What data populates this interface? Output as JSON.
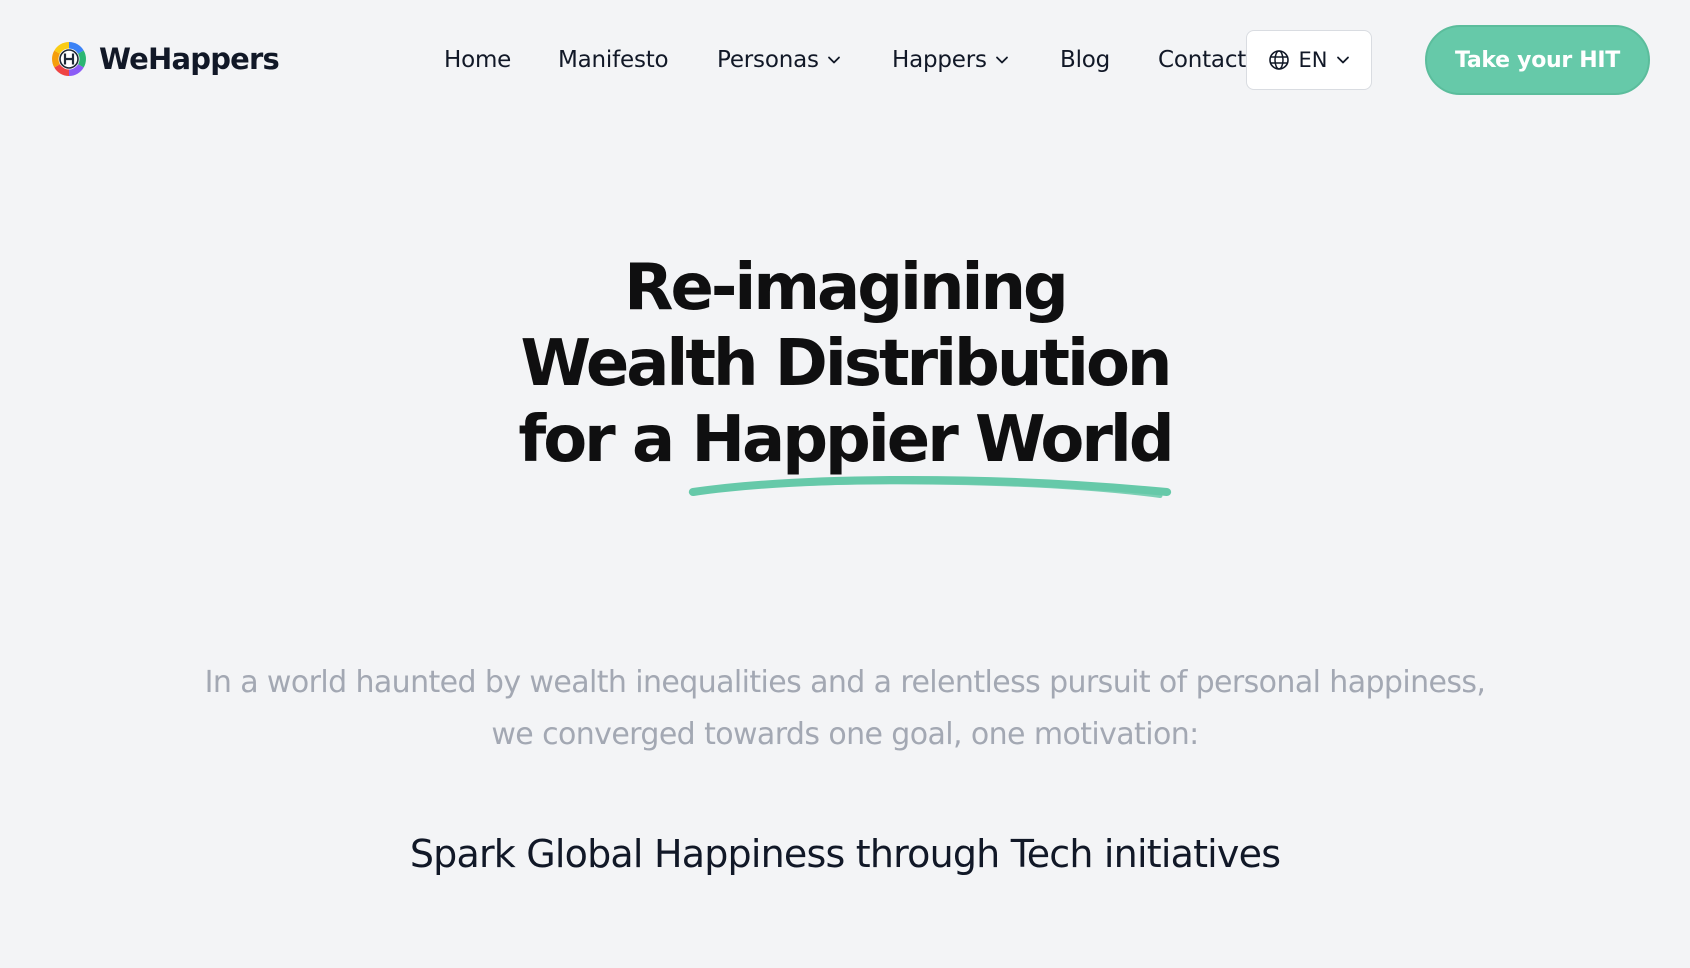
{
  "brand": {
    "name": "WeHappers",
    "logo_icon": "wehappers-logo-icon",
    "accent_color": "#66c9a9"
  },
  "nav": {
    "items": [
      {
        "label": "Home"
      },
      {
        "label": "Manifesto"
      },
      {
        "label": "Personas",
        "dropdown": true
      },
      {
        "label": "Happers",
        "dropdown": true
      },
      {
        "label": "Blog"
      },
      {
        "label": "Contact"
      }
    ]
  },
  "language": {
    "icon": "globe-icon",
    "selected": "EN"
  },
  "cta": {
    "label": "Take your HIT"
  },
  "hero": {
    "line1": "Re-imagining",
    "line2": "Wealth Distribution",
    "line3_prefix": "for a ",
    "line3_highlight": "Happier World",
    "underline_color": "#66c9a9"
  },
  "intro": {
    "line1": "In a world haunted by wealth inequalities and a relentless pursuit of personal happiness,",
    "line2": "we converged towards one goal, one motivation:"
  },
  "subhead": {
    "text": "Spark Global Happiness through Tech initiatives"
  }
}
